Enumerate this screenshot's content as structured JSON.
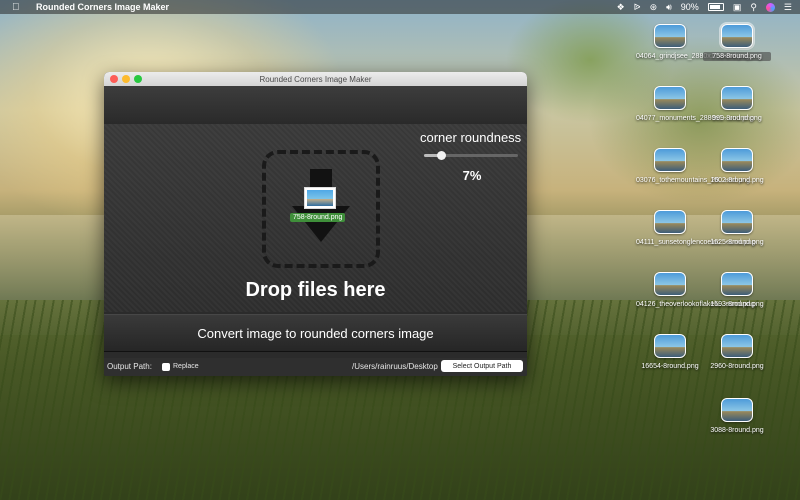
{
  "menubar": {
    "app_name": "Rounded Corners Image Maker",
    "battery": "90%"
  },
  "window": {
    "title": "Rounded Corners Image Maker",
    "dropped_file": "758-8round.png",
    "drop_label": "Drop files here",
    "slider_label": "corner roundness",
    "slider_value": "7%",
    "slider_fraction": 0.07,
    "convert_label": "Convert image to rounded corners image",
    "output_label": "Output Path:",
    "replace_label": "Replace",
    "output_path": "/Users/rainruus/Desktop",
    "select_button": "Select Output Path"
  },
  "desktop_icons": [
    {
      "name": "04064_grindjsee_2880x1...ound.png"
    },
    {
      "name": "758-8round.png"
    },
    {
      "name": "04077_monuments_2880x1...und.png"
    },
    {
      "name": "999-8round.png"
    },
    {
      "name": "03076_tothemountains_28...und.png"
    },
    {
      "name": "1602-8round.png"
    },
    {
      "name": "04111_sunsetonglencoeloc...ound.png"
    },
    {
      "name": "1625-8round.png"
    },
    {
      "name": "04126_theoverlookoflakelu...ound.png"
    },
    {
      "name": "1693-8round.png"
    },
    {
      "name": "16654-8round.png"
    },
    {
      "name": "2960-8round.png"
    },
    {
      "name": "3088-8round.png"
    }
  ]
}
